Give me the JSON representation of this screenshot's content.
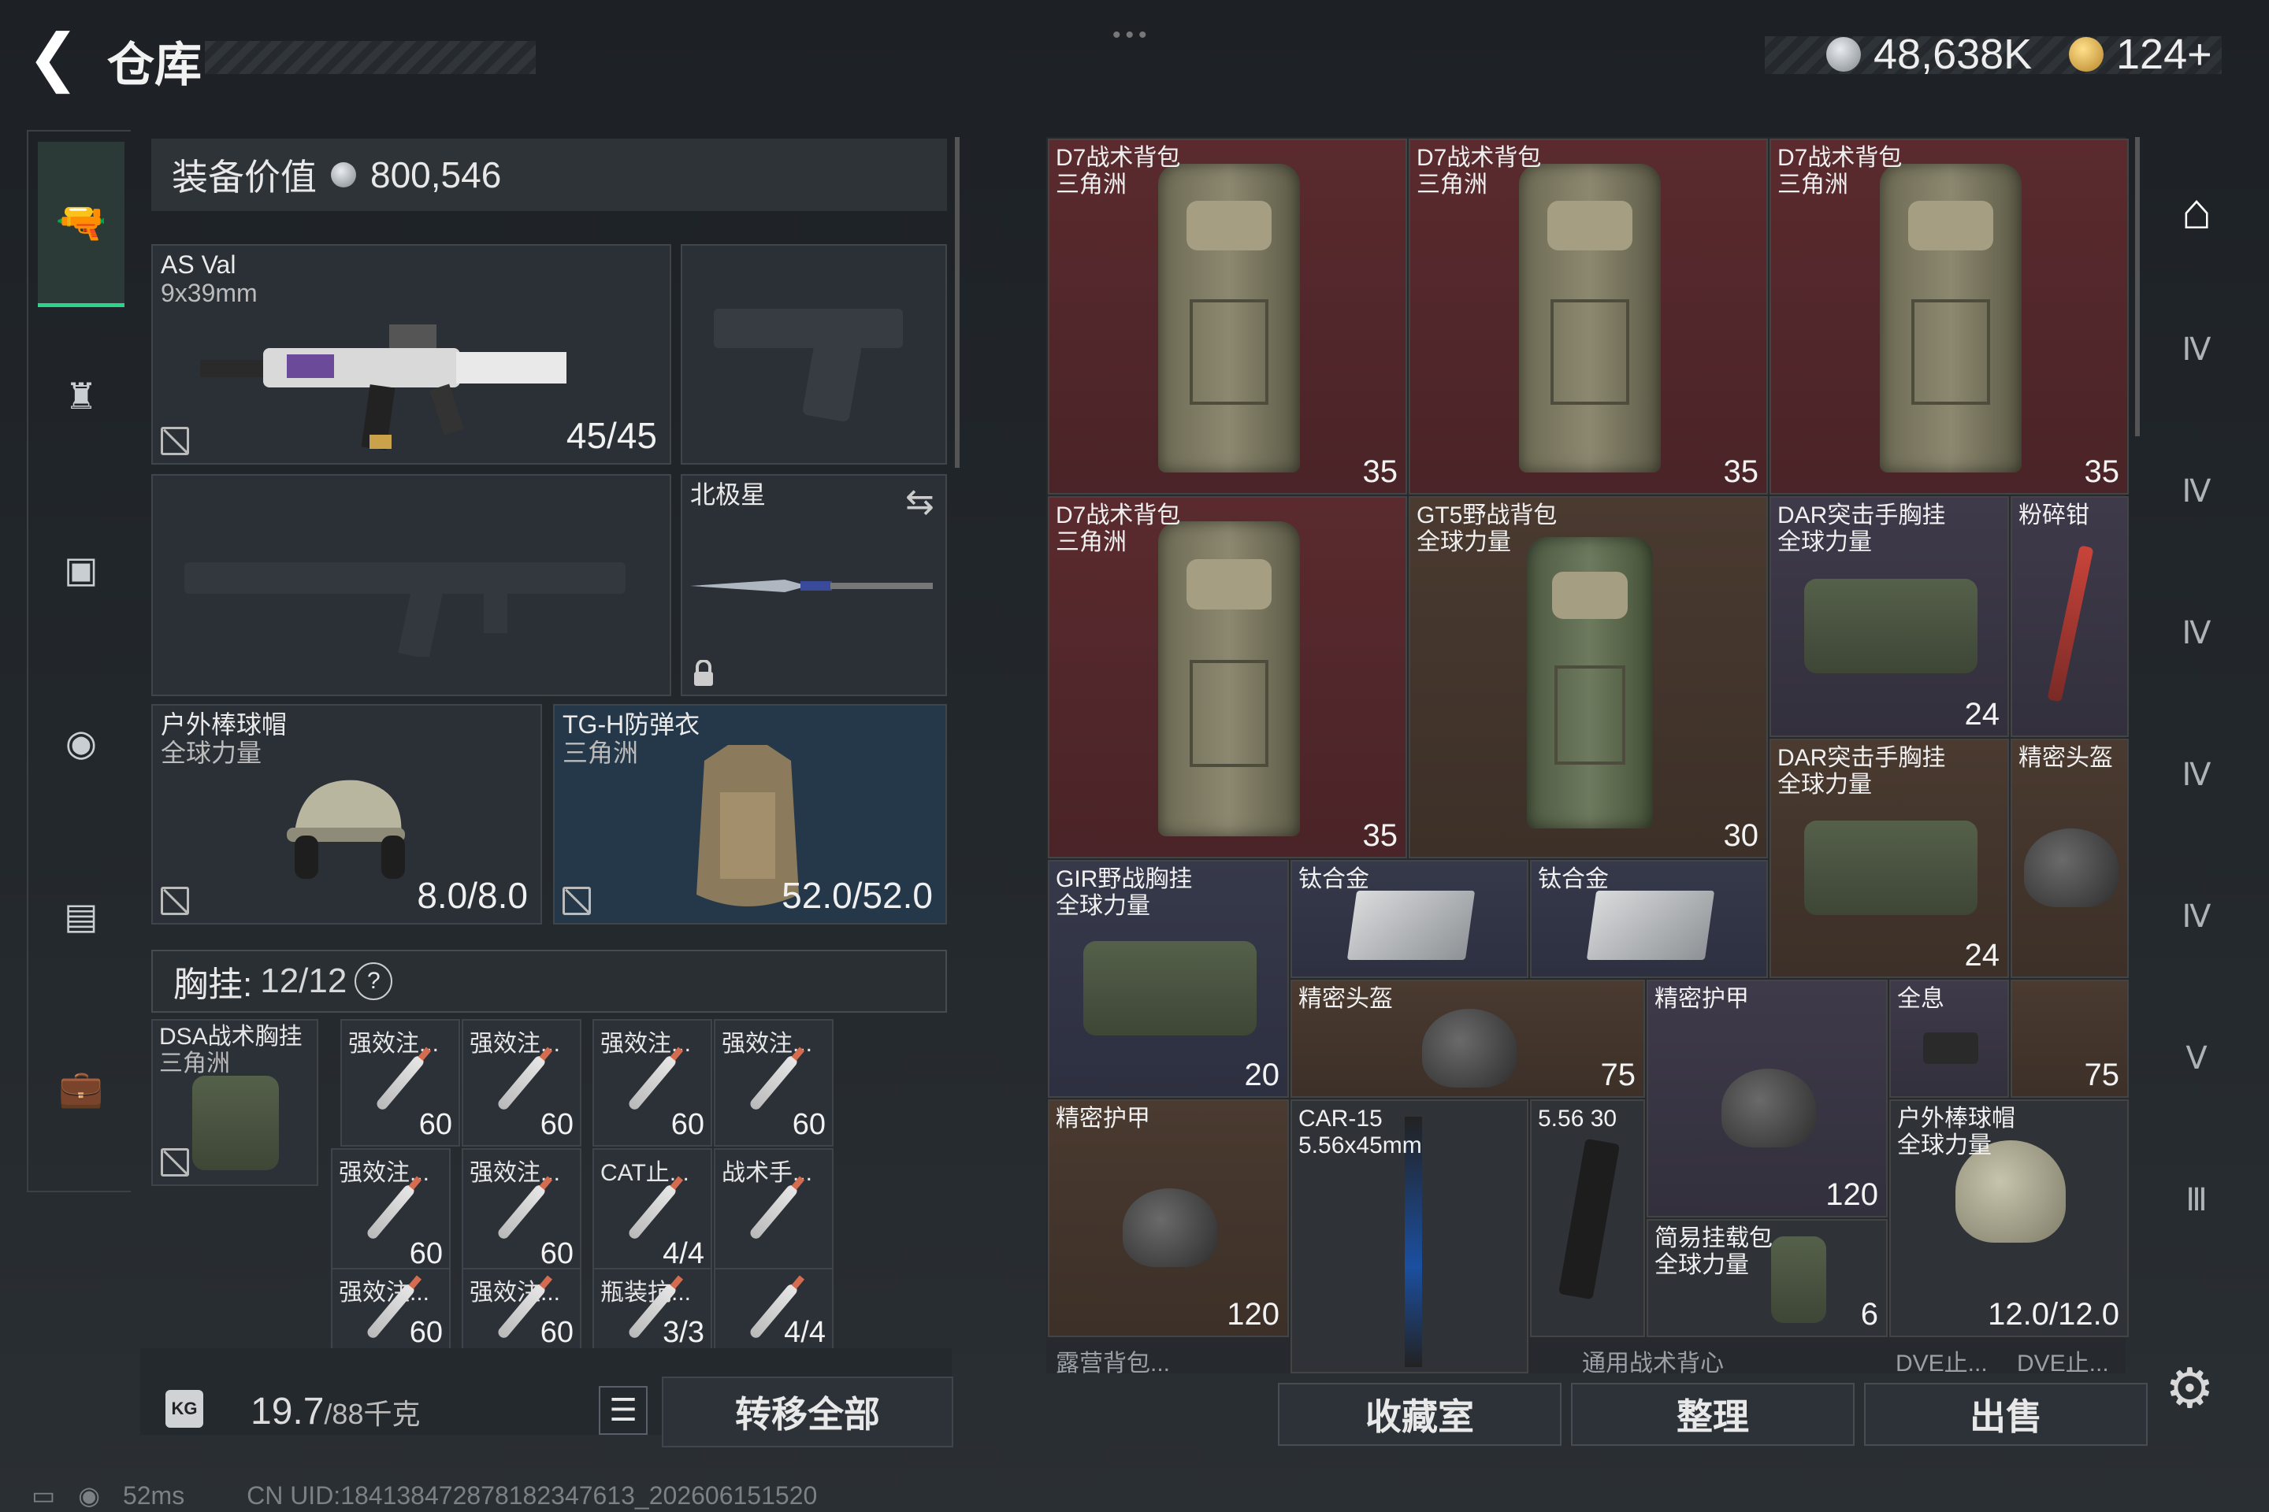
{
  "header": {
    "title": "仓库",
    "currency1": "48,638K",
    "currency2": "124+"
  },
  "equipment": {
    "value_label": "装备价值",
    "value": "800,546",
    "primary": {
      "name": "AS Val",
      "caliber": "9x39mm",
      "ammo": "45/45"
    },
    "secondary_label": "北极星",
    "hat": {
      "name": "户外棒球帽",
      "sub": "全球力量",
      "durability": "8.0/8.0"
    },
    "armor": {
      "name": "TG-H防弹衣",
      "sub": "三角洲",
      "durability": "52.0/52.0"
    },
    "vest_label": "胸挂:",
    "vest_capacity": "12/12",
    "vest_item": {
      "name": "DSA战术胸挂",
      "sub": "三角洲"
    },
    "vest_cells": [
      {
        "name": "强效注...",
        "qty": "60"
      },
      {
        "name": "强效注...",
        "qty": "60"
      },
      {
        "name": "强效注...",
        "qty": "60"
      },
      {
        "name": "强效注...",
        "qty": "60"
      },
      {
        "name": "强效注...",
        "qty": "60"
      },
      {
        "name": "强效注...",
        "qty": "60"
      },
      {
        "name": "CAT止...",
        "qty": "4/4"
      },
      {
        "name": "战术手...",
        "qty": ""
      },
      {
        "name": "强效注...",
        "qty": "60"
      },
      {
        "name": "强效注...",
        "qty": "60"
      },
      {
        "name": "瓶装抗...",
        "qty": "3/3"
      },
      {
        "name": "",
        "qty": "4/4"
      }
    ],
    "weight": "19.7",
    "weight_max": "/88千克",
    "transfer_all": "转移全部"
  },
  "stash": {
    "items": [
      {
        "name": "D7战术背包",
        "sub": "三角洲",
        "qty": "35"
      },
      {
        "name": "D7战术背包",
        "sub": "三角洲",
        "qty": "35"
      },
      {
        "name": "D7战术背包",
        "sub": "三角洲",
        "qty": "35"
      },
      {
        "name": "D7战术背包",
        "sub": "三角洲",
        "qty": "35"
      },
      {
        "name": "GT5野战背包",
        "sub": "全球力量",
        "qty": "30"
      },
      {
        "name": "DAR突击手胸挂",
        "sub": "全球力量",
        "qty": "24"
      },
      {
        "name": "粉碎钳",
        "sub": "",
        "qty": ""
      },
      {
        "name": "DAR突击手胸挂",
        "sub": "全球力量",
        "qty": "24"
      },
      {
        "name": "精密头盔",
        "sub": "",
        "qty": ""
      },
      {
        "name": "GIR野战胸挂",
        "sub": "全球力量",
        "qty": "20"
      },
      {
        "name": "钛合金",
        "sub": "",
        "qty": ""
      },
      {
        "name": "钛合金",
        "sub": "",
        "qty": ""
      },
      {
        "name": "精密头盔",
        "sub": "",
        "qty": "75"
      },
      {
        "name": "精密护甲",
        "sub": "",
        "qty": "120"
      },
      {
        "name": "全息",
        "sub": "",
        "qty": ""
      },
      {
        "name": "",
        "sub": "",
        "qty": "75"
      },
      {
        "name": "精密护甲",
        "sub": "",
        "qty": "120"
      },
      {
        "name": "CAR-15",
        "sub": "5.56x45mm",
        "qty": ""
      },
      {
        "name": "5.56 30",
        "sub": "",
        "qty": ""
      },
      {
        "name": "简易挂载包",
        "sub": "全球力量",
        "qty": "6"
      },
      {
        "name": "户外棒球帽",
        "sub": "全球力量",
        "qty": "12.0/12.0"
      }
    ],
    "cut_labels": [
      "露营背包...",
      "通用战术背心",
      "DVE止...",
      "DVE止..."
    ],
    "buttons": {
      "collection": "收藏室",
      "organize": "整理",
      "sell": "出售"
    }
  },
  "status": {
    "ping": "52ms",
    "uid": "CN UID:18413847287818234761​3_202606151520"
  }
}
